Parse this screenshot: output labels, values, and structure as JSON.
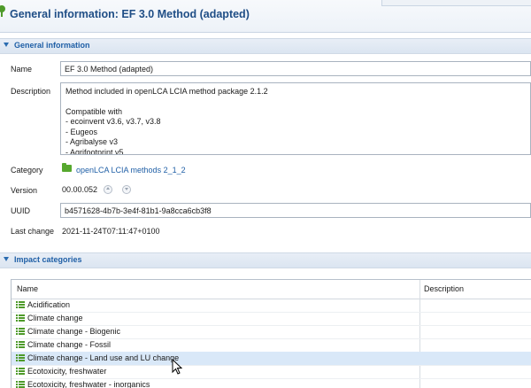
{
  "header": {
    "title": "General information: EF 3.0 Method (adapted)"
  },
  "general_section": {
    "label": "General information"
  },
  "fields": {
    "name_label": "Name",
    "name_value": "EF 3.0 Method (adapted)",
    "description_label": "Description",
    "description_lines": [
      "Method included in openLCA LCIA method package 2.1.2",
      "",
      "Compatible with",
      "- ecoinvent v3.6, v3.7, v3.8",
      "- Eugeos",
      "- Agribalyse v3",
      "- Agrifootprint v5"
    ],
    "category_label": "Category",
    "category_value": "openLCA LCIA methods 2_1_2",
    "version_label": "Version",
    "version_value": "00.00.052",
    "uuid_label": "UUID",
    "uuid_value": "b4571628-4b7b-3e4f-81b1-9a8cca6cb3f8",
    "last_change_label": "Last change",
    "last_change_value": "2021-11-24T07:11:47+0100"
  },
  "impact_section": {
    "label": "Impact categories"
  },
  "impact_table": {
    "columns": [
      "Name",
      "Description"
    ],
    "rows": [
      "Acidification",
      "Climate change",
      "Climate change - Biogenic",
      "Climate change - Fossil",
      "Climate change - Land use and LU change",
      "Ecotoxicity, freshwater",
      "Ecotoxicity, freshwater - inorganics"
    ],
    "selected_row": "Climate change - Land use and LU change"
  },
  "colors": {
    "title": "#1f4e86",
    "section_label": "#1f5fa6",
    "icon_green": "#4e9a2a",
    "selected_row": "#d9e8f8"
  },
  "icons": {
    "header": "openlca-method-icon",
    "category": "folder-icon",
    "impact_item": "impact-category-list-icon",
    "version_up": "version-up-icon",
    "version_down": "version-down-icon"
  }
}
